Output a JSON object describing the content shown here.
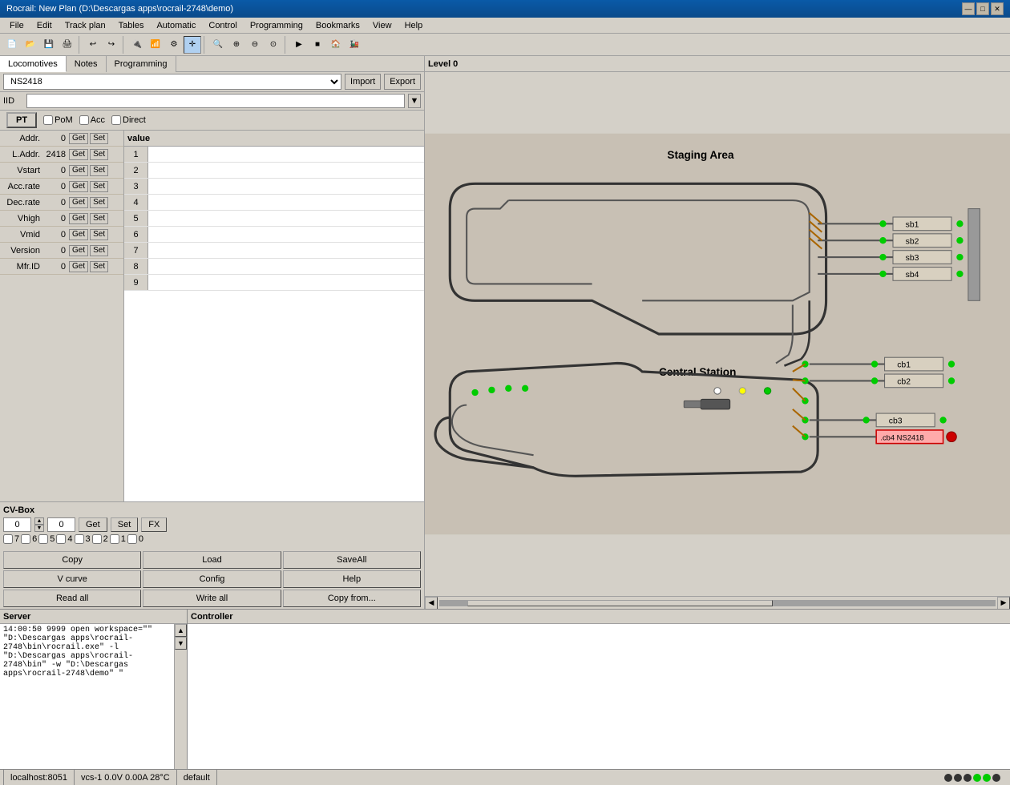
{
  "window": {
    "title": "Rocrail: New Plan (D:\\Descargas apps\\rocrail-2748\\demo)",
    "min_btn": "—",
    "max_btn": "□",
    "close_btn": "✕"
  },
  "menu": {
    "items": [
      "File",
      "Edit",
      "Track plan",
      "Tables",
      "Automatic",
      "Control",
      "Programming",
      "Bookmarks",
      "View",
      "Help"
    ]
  },
  "tabs": {
    "items": [
      "Locomotives",
      "Notes",
      "Programming"
    ]
  },
  "loco_selector": {
    "selected": "NS2418",
    "import_label": "Import",
    "export_label": "Export"
  },
  "iid": {
    "label": "IID",
    "value": ""
  },
  "pt_row": {
    "pt_label": "PT",
    "pom_label": "PoM",
    "acc_label": "Acc",
    "direct_label": "Direct"
  },
  "params": [
    {
      "name": "Addr.",
      "val": "0",
      "get": "Get",
      "set": "Set"
    },
    {
      "name": "L.Addr.",
      "val": "2418",
      "get": "Get",
      "set": "Set"
    },
    {
      "name": "Vstart",
      "val": "0",
      "get": "Get",
      "set": "Set"
    },
    {
      "name": "Acc.rate",
      "val": "0",
      "get": "Get",
      "set": "Set"
    },
    {
      "name": "Dec.rate",
      "val": "0",
      "get": "Get",
      "set": "Set"
    },
    {
      "name": "Vhigh",
      "val": "0",
      "get": "Get",
      "set": "Set"
    },
    {
      "name": "Vmid",
      "val": "0",
      "get": "Get",
      "set": "Set"
    },
    {
      "name": "Version",
      "val": "0",
      "get": "Get",
      "set": "Set"
    },
    {
      "name": "Mfr.ID",
      "val": "0",
      "get": "Get",
      "set": "Set"
    }
  ],
  "cv_header": {
    "value_label": "value"
  },
  "cv_rows": [
    {
      "num": "1"
    },
    {
      "num": "2"
    },
    {
      "num": "3"
    },
    {
      "num": "4"
    },
    {
      "num": "5"
    },
    {
      "num": "6"
    },
    {
      "num": "7"
    },
    {
      "num": "8"
    },
    {
      "num": "9"
    }
  ],
  "cv_box": {
    "label": "CV-Box",
    "cv_num": "0",
    "cv_val": "0",
    "get_label": "Get",
    "set_label": "Set",
    "fx_label": "FX",
    "bits": [
      "7",
      "6",
      "5",
      "4",
      "3",
      "2",
      "1",
      "0"
    ]
  },
  "buttons": {
    "copy": "Copy",
    "load": "Load",
    "save_all": "SaveAll",
    "v_curve": "V curve",
    "config": "Config",
    "help": "Help",
    "read_all": "Read all",
    "write_all": "Write all",
    "copy_from": "Copy from..."
  },
  "track": {
    "level_label": "Level 0",
    "staging_area_label": "Staging Area",
    "central_station_label": "Central Station",
    "blocks": [
      {
        "id": "sb1",
        "label": "sb1"
      },
      {
        "id": "sb2",
        "label": "sb2"
      },
      {
        "id": "sb3",
        "label": "sb3"
      },
      {
        "id": "sb4",
        "label": "sb4"
      },
      {
        "id": "cb1",
        "label": "cb1"
      },
      {
        "id": "cb2",
        "label": "cb2"
      },
      {
        "id": "cb3",
        "label": "cb3"
      },
      {
        "id": "cb4",
        "label": ".cb4 NS2418"
      }
    ]
  },
  "status_bar": {
    "server": "localhost:8051",
    "vcs": "vcs-1 0.0V 0.00A 28°C",
    "profile": "default",
    "dots": [
      "dark",
      "dark",
      "dark",
      "green",
      "green",
      "dark"
    ]
  },
  "server": {
    "label": "Server",
    "log": "14:00:50 9999 open workspace=\"\" \"D:\\Descargas apps\\rocrail-2748\\bin\\rocrail.exe\" -l \"D:\\Descargas apps\\rocrail-2748\\bin\" -w \"D:\\Descargas apps\\rocrail-2748\\demo\" \""
  },
  "controller": {
    "label": "Controller"
  }
}
